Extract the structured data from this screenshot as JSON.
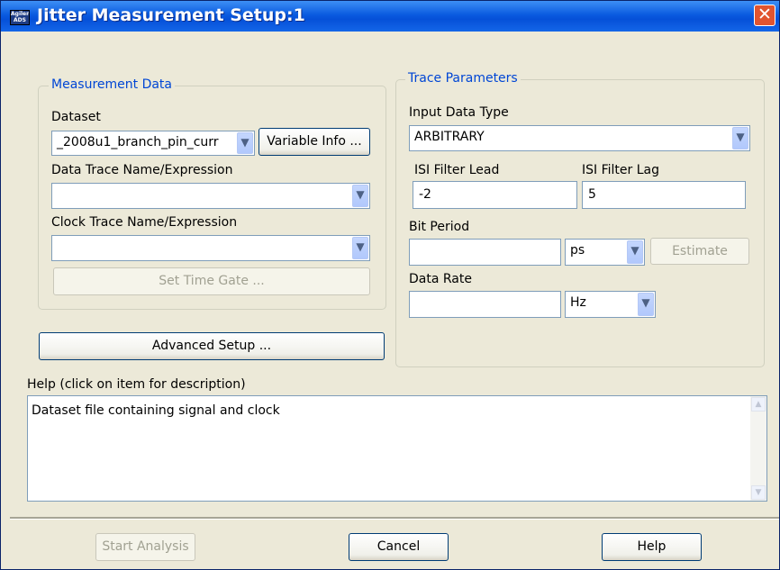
{
  "window": {
    "title": "Jitter Measurement Setup:1",
    "app_icon_text": "Agilent ADS",
    "close_glyph": "✕"
  },
  "measurement": {
    "group_label": "Measurement Data",
    "dataset_label": "Dataset",
    "dataset_value": "_2008u1_branch_pin_curr",
    "variable_info_button": "Variable Info ...",
    "data_trace_label": "Data Trace Name/Expression",
    "data_trace_value": "",
    "clock_trace_label": "Clock Trace Name/Expression",
    "clock_trace_value": "",
    "set_time_gate_button": "Set Time Gate ..."
  },
  "advanced_setup_button": "Advanced Setup ...",
  "trace": {
    "group_label": "Trace Parameters",
    "input_type_label": "Input Data Type",
    "input_type_value": "ARBITRARY",
    "isi_lead_label": "ISI Filter Lead",
    "isi_lead_value": "-2",
    "isi_lag_label": "ISI Filter Lag",
    "isi_lag_value": "5",
    "bit_period_label": "Bit Period",
    "bit_period_value": "",
    "bit_period_unit": "ps",
    "estimate_button": "Estimate",
    "data_rate_label": "Data Rate",
    "data_rate_value": "",
    "data_rate_unit": "Hz"
  },
  "help": {
    "label": "Help (click on item for description)",
    "text": "Dataset file containing signal and clock"
  },
  "footer": {
    "start_button": "Start Analysis",
    "cancel_button": "Cancel",
    "help_button": "Help"
  },
  "icons": {
    "dropdown": "▼",
    "scroll_up": "▲",
    "scroll_down": "▼"
  }
}
